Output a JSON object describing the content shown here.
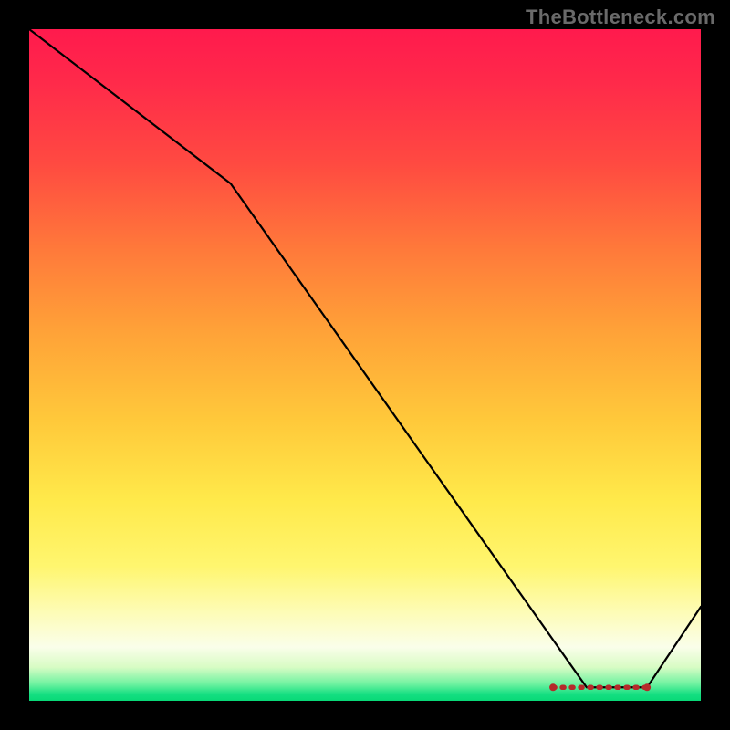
{
  "watermark": "TheBottleneck.com",
  "colors": {
    "frame_bg": "#000000",
    "curve": "#000000",
    "dashed_marker": "#b52a2a",
    "gradient_top": "#ff1a4d",
    "gradient_mid": "#ffe94a",
    "gradient_bottom": "#08d977"
  },
  "chart_data": {
    "type": "line",
    "title": "",
    "xlabel": "",
    "ylabel": "",
    "xlim": [
      0,
      100
    ],
    "ylim": [
      0,
      100
    ],
    "grid": false,
    "legend": false,
    "series": [
      {
        "name": "curve",
        "x": [
          0,
          30,
          83,
          92,
          100
        ],
        "y": [
          100,
          77,
          2,
          2,
          14
        ]
      }
    ],
    "annotations": [
      {
        "name": "dashed-marker",
        "x_range": [
          78,
          92
        ],
        "y": 2
      }
    ]
  }
}
